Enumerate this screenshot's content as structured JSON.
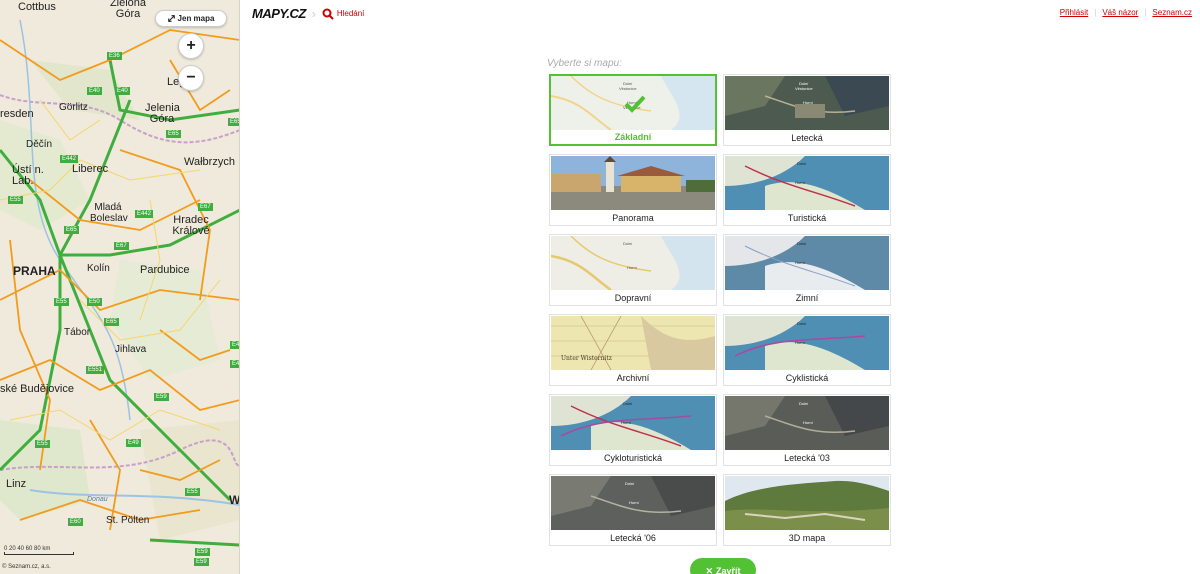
{
  "map": {
    "jen_mapa_label": "Jen mapa",
    "zoom_in": "+",
    "zoom_out": "−",
    "cities": [
      "Cottbus",
      "Zielona Góra",
      "Leg",
      "Görlitz",
      "Jelenia Góra",
      "resden",
      "Děčín",
      "Wałbrzych",
      "Liberec",
      "Ústí n. Lab.",
      "Mladá Boleslav",
      "Hradec Králové",
      "PRAHA",
      "Kolín",
      "Pardubice",
      "Tábor",
      "Jihlava",
      "ské Budějovice",
      "Linz",
      "Donau",
      "St. Pölten",
      "W"
    ],
    "roads": [
      "E36",
      "E40",
      "E40",
      "E65",
      "E442",
      "E55",
      "E65",
      "E67",
      "E67",
      "E55",
      "E50",
      "E65",
      "E551",
      "E59",
      "E55",
      "E49",
      "E55",
      "E60",
      "E59",
      "E59",
      "E461",
      "E461",
      "E65",
      "E442"
    ],
    "scale_label": "0  20  40  60  80 km",
    "copyright": "© Seznam.cz, a.s."
  },
  "header": {
    "logo_text": "MAPY.CZ",
    "search_label": "Hledání",
    "links": [
      "Přihlásit",
      "Váš názor",
      "Seznam.cz"
    ]
  },
  "picker": {
    "title": "Vyberte si mapu:",
    "tiles": [
      {
        "label": "Základní",
        "selected": true,
        "kind": "basic"
      },
      {
        "label": "Letecká",
        "selected": false,
        "kind": "aerial"
      },
      {
        "label": "Panorama",
        "selected": false,
        "kind": "panorama"
      },
      {
        "label": "Turistická",
        "selected": false,
        "kind": "tourist"
      },
      {
        "label": "Dopravní",
        "selected": false,
        "kind": "traffic"
      },
      {
        "label": "Zimní",
        "selected": false,
        "kind": "winter"
      },
      {
        "label": "Archivní",
        "selected": false,
        "kind": "archive"
      },
      {
        "label": "Cyklistická",
        "selected": false,
        "kind": "cycle"
      },
      {
        "label": "Cykloturistická",
        "selected": false,
        "kind": "cyclotour"
      },
      {
        "label": "Letecká '03",
        "selected": false,
        "kind": "aerial03"
      },
      {
        "label": "Letecká '06",
        "selected": false,
        "kind": "aerial06"
      },
      {
        "label": "3D mapa",
        "selected": false,
        "kind": "3d"
      }
    ],
    "close_label": "Zavřít"
  },
  "colors": {
    "accent_green": "#52c234",
    "link_red": "#cc0000",
    "selected_border": "#52c234"
  }
}
